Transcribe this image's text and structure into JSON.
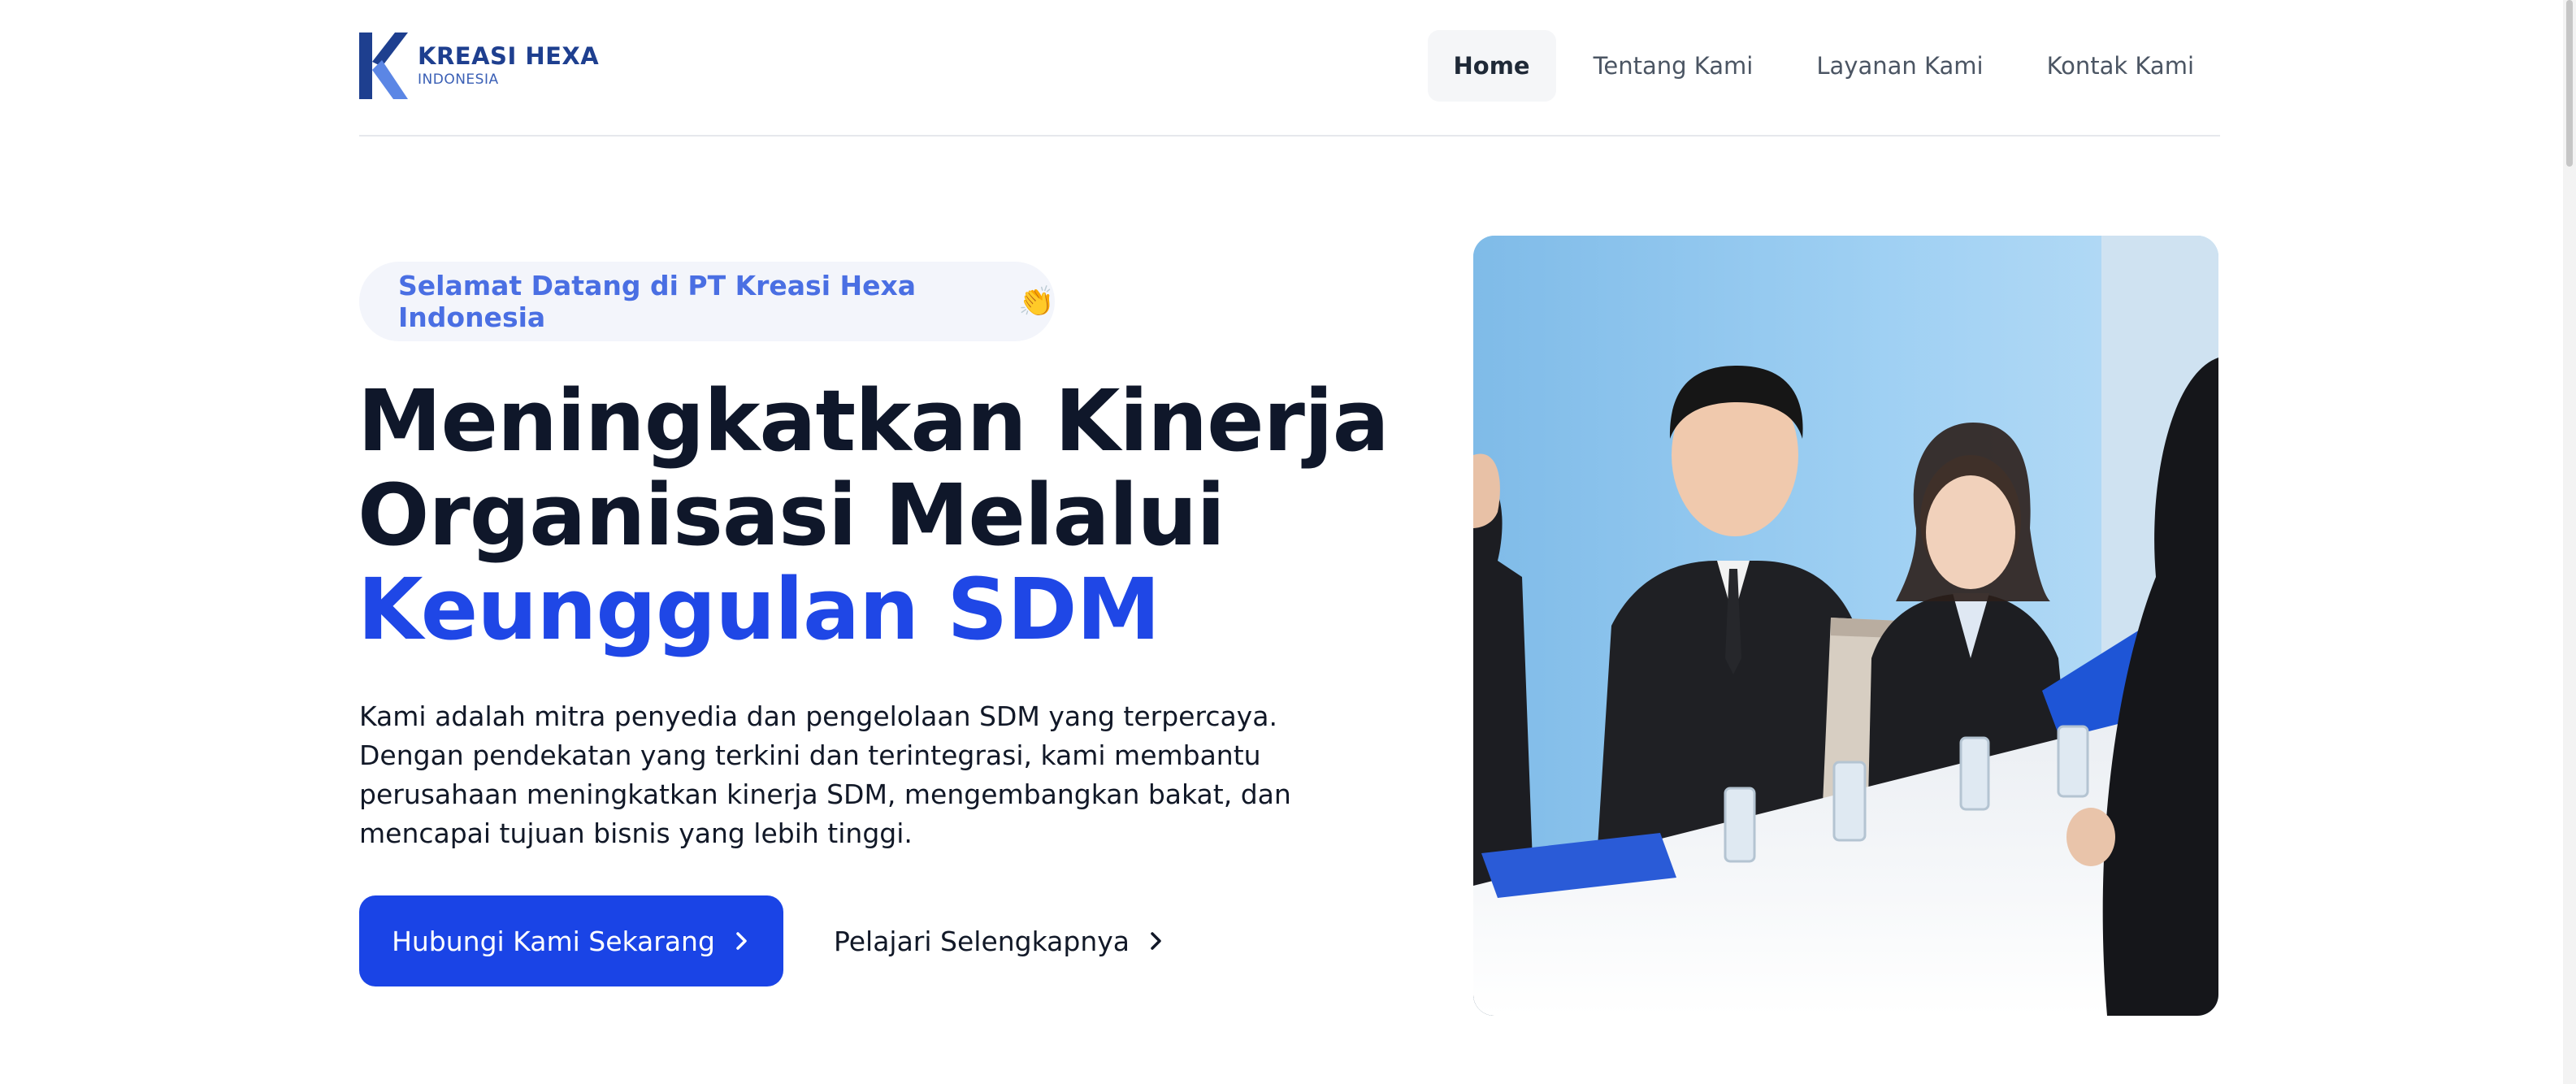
{
  "brand": {
    "name": "KREASI HEXA",
    "sub": "INDONESIA",
    "color": "#1e3f8f"
  },
  "nav": [
    {
      "label": "Home",
      "active": true
    },
    {
      "label": "Tentang Kami",
      "active": false
    },
    {
      "label": "Layanan Kami",
      "active": false
    },
    {
      "label": "Kontak Kami",
      "active": false
    }
  ],
  "hero": {
    "badge": "Selamat Datang di PT Kreasi Hexa Indonesia",
    "badge_emoji": "👏",
    "headline_line1": "Meningkatkan Kinerja",
    "headline_line2": "Organisasi Melalui",
    "headline_accent": "Keunggulan SDM",
    "description": "Kami adalah mitra penyedia dan pengelolaan SDM yang terpercaya. Dengan pendekatan yang terkini dan terintegrasi, kami membantu perusahaan meningkatkan kinerja SDM, mengembangkan bakat, dan mencapai tujuan bisnis yang lebih tinggi.",
    "primary_button": "Hubungi Kami Sekarang",
    "secondary_button": "Pelajari Selengkapnya",
    "image_icon": "office-meeting-photo"
  },
  "colors": {
    "accent": "#1f47e6",
    "badge_text": "#4a6fe3",
    "badge_bg": "#f3f5fb"
  }
}
